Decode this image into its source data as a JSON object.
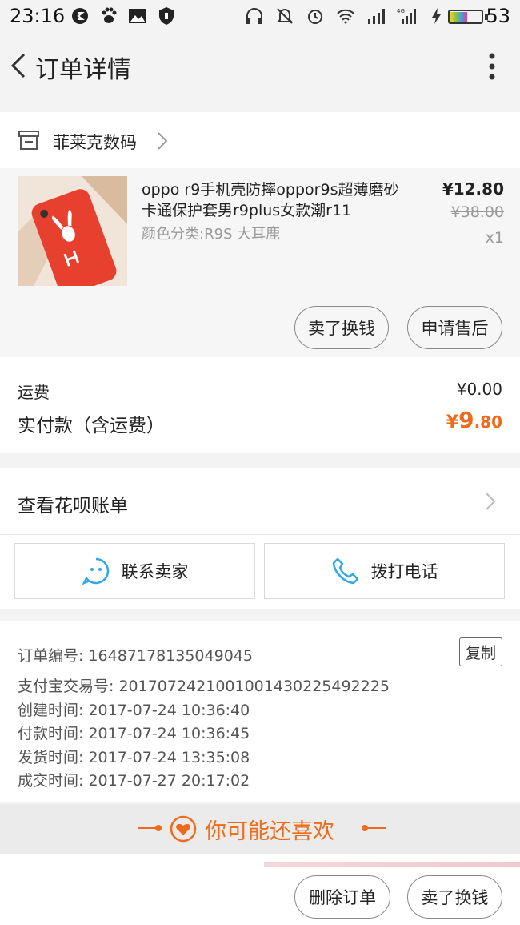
{
  "status_bar": {
    "time": "23:16",
    "battery_percent": "53",
    "left_icons": [
      "shield-s-icon",
      "baidu-paw-icon",
      "image-message-icon",
      "shield-icon"
    ],
    "right_icons": [
      "headset-icon",
      "mute-icon",
      "alarm-icon",
      "wifi-icon",
      "signal-icon",
      "signal-4g-icon",
      "charging-icon"
    ],
    "network_label": "4G"
  },
  "header": {
    "title": "订单详情",
    "back_icon": "chevron-left-icon",
    "menu_icon": "more-vertical-icon"
  },
  "shop": {
    "name": "菲莱克数码",
    "icon": "store-icon"
  },
  "product": {
    "title": "oppo r9手机壳防摔oppor9s超薄磨砂卡通保护套男r9plus女款潮r11",
    "variant": "颜色分类:R9S 大耳鹿",
    "price": "¥12.80",
    "original_price": "¥38.00",
    "quantity": "x1",
    "actions": [
      "卖了换钱",
      "申请售后"
    ]
  },
  "payment": {
    "shipping_label": "运费",
    "shipping_value": "¥0.00",
    "paid_label": "实付款（含运费）",
    "paid_currency": "¥",
    "paid_integer": "9",
    "paid_decimal": ".80",
    "accent_color": "#ef6b1c"
  },
  "huabei": {
    "label": "查看花呗账单"
  },
  "contact": {
    "seller_label": "联系卖家",
    "call_label": "拨打电话",
    "icon_color": "#2fa8e8"
  },
  "order_info": {
    "order_no_label": "订单编号: ",
    "order_no": "1648717813504904",
    "order_no_tail": "5",
    "copy_label": "复制",
    "rows": [
      "支付宝交易号: 2017072421001001430225492225",
      "创建时间: 2017-07-24 10:36:40",
      "付款时间: 2017-07-24 10:36:45",
      "发货时间: 2017-07-24 13:35:08",
      "成交时间: 2017-07-27 20:17:02"
    ]
  },
  "recommend": {
    "label": "你可能还喜欢"
  },
  "bottom_bar": {
    "delete_label": "删除订单",
    "resell_label": "卖了换钱"
  }
}
